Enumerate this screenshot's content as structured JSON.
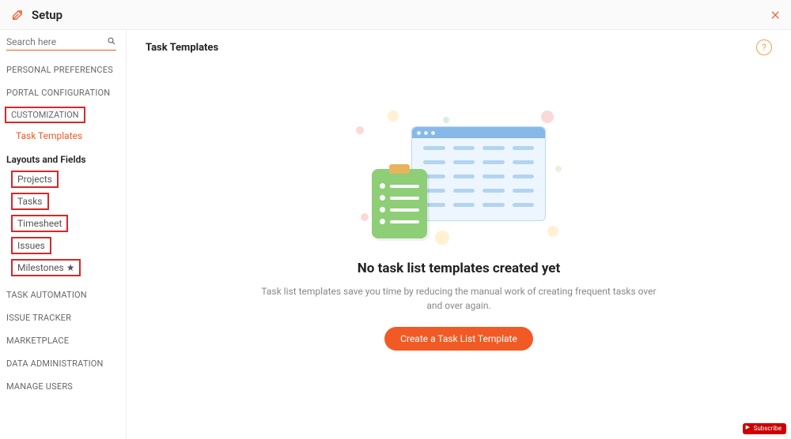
{
  "header": {
    "title": "Setup"
  },
  "search": {
    "placeholder": "Search here"
  },
  "sidebar": {
    "sections_top": [
      {
        "label": "PERSONAL PREFERENCES"
      },
      {
        "label": "PORTAL CONFIGURATION"
      }
    ],
    "customization_label": "CUSTOMIZATION",
    "task_templates_label": "Task Templates",
    "layouts_header": "Layouts and Fields",
    "layout_items": [
      {
        "label": "Projects"
      },
      {
        "label": "Tasks"
      },
      {
        "label": "Timesheet"
      },
      {
        "label": "Issues"
      },
      {
        "label": "Milestones",
        "star": true
      }
    ],
    "sections_bottom": [
      {
        "label": "TASK AUTOMATION"
      },
      {
        "label": "ISSUE TRACKER"
      },
      {
        "label": "MARKETPLACE"
      },
      {
        "label": "DATA ADMINISTRATION"
      },
      {
        "label": "MANAGE USERS"
      }
    ]
  },
  "main": {
    "title": "Task Templates",
    "empty_heading": "No task list templates created yet",
    "empty_text": "Task list templates save you time by reducing the manual work of creating frequent tasks over and over again.",
    "cta": "Create a Task List Template"
  },
  "badge": {
    "label": "Subscribe"
  }
}
